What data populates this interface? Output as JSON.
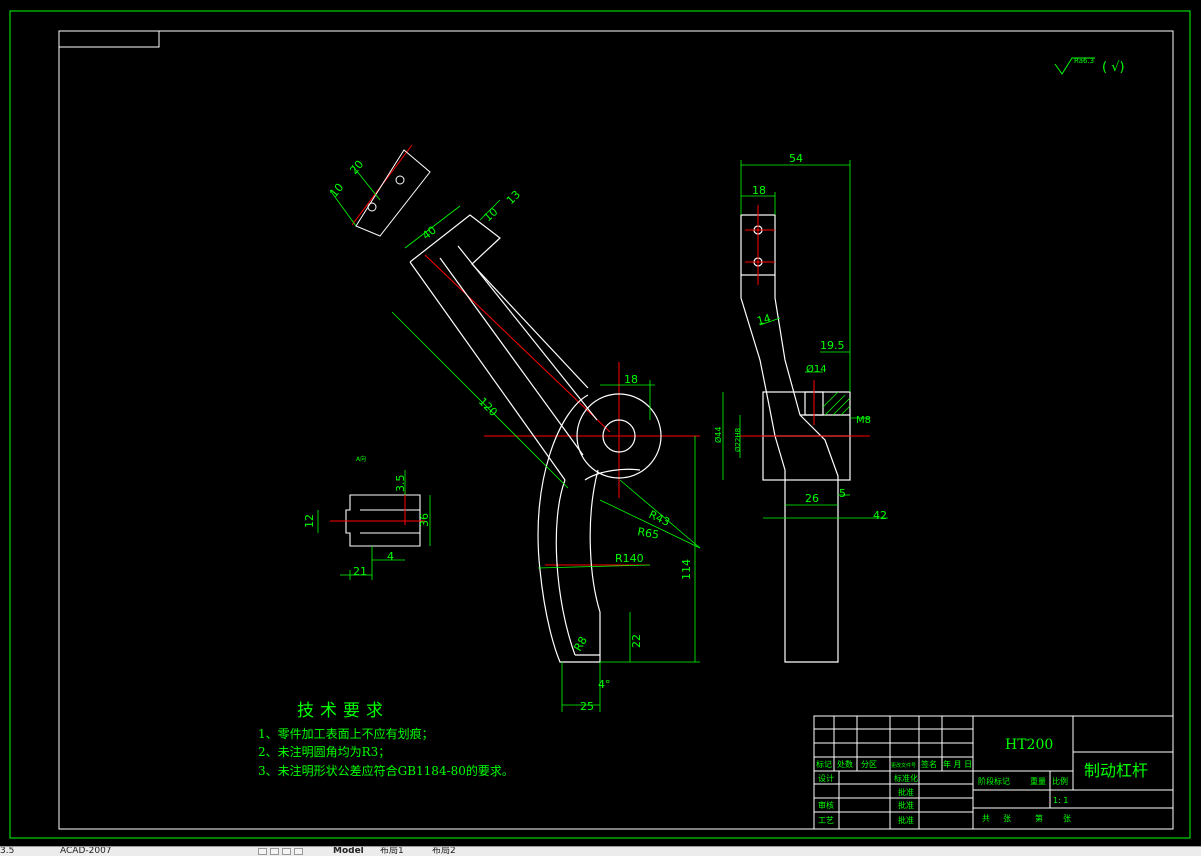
{
  "colors": {
    "background": "#000000",
    "border": "#00ff00",
    "geometry": "#ffffff",
    "dimension": "#00ff00",
    "centerline": "#ff0000",
    "hatch": "#00ff00"
  },
  "drawing": {
    "roughness_symbol": "Ra6.3",
    "roughness_suffix": "( √)",
    "dims": {
      "d20": "20",
      "d10a": "10",
      "d40": "40",
      "d13": "13",
      "d10b": "10",
      "d120": "120",
      "d18a": "18",
      "d54": "54",
      "d18b": "18",
      "d14a": "14",
      "d19_5": "19.5",
      "dphi14": "Ø14",
      "dm8": "M8",
      "dphi44": "Ø44",
      "dphi22": "Ø22H8",
      "d26": "26",
      "d5": "5",
      "d42": "42",
      "r43": "R43",
      "r65": "R65",
      "r140": "R140",
      "d114": "114",
      "d22": "22",
      "r8": "R8",
      "d4deg": "4°",
      "d25": "25",
      "d3_5": "3.5",
      "d12": "12",
      "d36": "36",
      "d21": "21",
      "d4": "4",
      "section_label": "A向"
    },
    "tech_title": "技术要求",
    "tech_items": [
      "1、零件加工表面上不应有划痕；",
      "2、未注明圆角均为R3；",
      "3、未注明形状公差应符合GB1184-80的要求。"
    ]
  },
  "title_block": {
    "material": "HT200",
    "part_name": "制动杠杆",
    "header_cells": [
      "标记",
      "处数",
      "分区",
      "更改文件号",
      "签名",
      "年 月 日"
    ],
    "row_design": [
      "设计",
      "标准化"
    ],
    "row_stage": [
      "阶段标记",
      "重量",
      "比例"
    ],
    "scale": "1: 1",
    "row_check": [
      "审核",
      "批准"
    ],
    "row_sheets": [
      "共",
      "张",
      "第",
      "张"
    ],
    "row_tech": [
      "工艺",
      "批准"
    ],
    "left_labels": [
      "审核",
      "工艺"
    ],
    "mid_labels": [
      "标准化",
      "批准",
      "审核",
      "批准"
    ]
  },
  "tabbar": {
    "status_text": "3.5",
    "app_text": "ACAD-2007",
    "tabs": [
      "Model",
      "布局1",
      "布局2"
    ]
  }
}
